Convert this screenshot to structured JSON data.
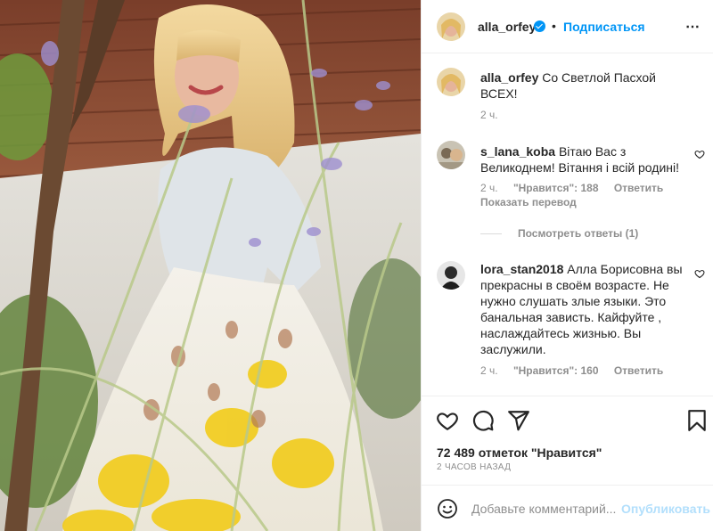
{
  "colors": {
    "accent": "#0095f6",
    "muted": "#8e8e8e",
    "text": "#262626",
    "post_disabled": "#b2dffc"
  },
  "header": {
    "username": "alla_orfey",
    "separator": "•",
    "follow_label": "Подписаться",
    "more_icon": "⋯"
  },
  "caption": {
    "username": "alla_orfey",
    "text": "Со Светлой Пасхой ВСЕХ!",
    "time": "2 ч."
  },
  "comments": [
    {
      "username": "s_lana_koba",
      "text": "Вітаю Вас з Великоднем! Вітання і всій родині!",
      "time": "2 ч.",
      "likes": "\"Нравится\": 188",
      "reply": "Ответить",
      "translate": "Показать перевод",
      "view_replies": "Посмотреть ответы (1)"
    },
    {
      "username": "lora_stan2018",
      "text": "Алла Борисовна вы прекрасны в своём возрасте. Не нужно слушать злые языки. Это банальная зависть. Кайфуйте , наслаждайтесь жизнью. Вы заслужили.",
      "time": "2 ч.",
      "likes": "\"Нравится\": 160",
      "reply": "Ответить"
    }
  ],
  "icons": {
    "like": "heart-icon",
    "comment": "comment-icon",
    "share": "share-icon",
    "save": "bookmark-icon",
    "emoji": "emoji-icon",
    "verified": "verified-badge-icon"
  },
  "stats": {
    "likes": "72 489 отметок \"Нравится\"",
    "time_ago": "2 ЧАСОВ НАЗАД"
  },
  "add_comment": {
    "placeholder": "Добавьте комментарий...",
    "post_label": "Опубликовать"
  }
}
